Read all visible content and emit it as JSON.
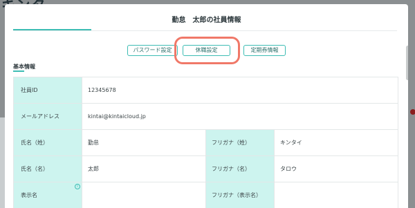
{
  "background": {
    "brand": "キンタ"
  },
  "modal": {
    "title": "勤怠　太郎の社員情報",
    "buttons": {
      "password": "パスワード設定",
      "leave": "休職設定",
      "commuter_pass": "定期券情報"
    },
    "section_title": "基本情報",
    "rows": [
      {
        "label": "社員ID",
        "value": "12345678"
      },
      {
        "label": "メールアドレス",
        "value": "kintai@kintaicloud.jp"
      },
      {
        "label": "氏名（姓）",
        "value": "勤怠",
        "label2": "フリガナ（姓）",
        "value2": "キンタイ"
      },
      {
        "label": "氏名（名）",
        "value": "太郎",
        "label2": "フリガナ（名）",
        "value2": "タロウ"
      },
      {
        "label": "表示名",
        "value": "",
        "label2": "フリガナ（表示名）",
        "value2": ""
      }
    ]
  },
  "colors": {
    "accent": "#3cbcb3",
    "label_bg": "#cdf4ef",
    "highlight": "#f07868"
  }
}
